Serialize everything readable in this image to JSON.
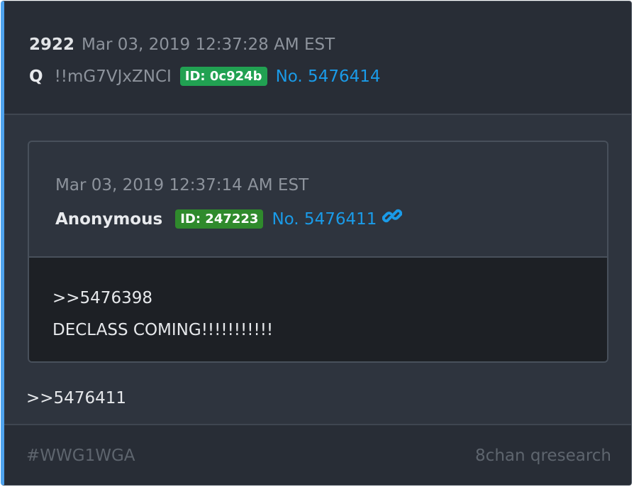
{
  "post": {
    "number": "2922",
    "date": "Mar 03, 2019 12:37:28 AM EST",
    "author": "Q",
    "tripcode": "!!mG7VJxZNCI",
    "id_badge": "ID: 0c924b",
    "post_number": "No. 5476414",
    "reply_text": ">>5476411"
  },
  "quoted": {
    "date": "Mar 03, 2019 12:37:14 AM EST",
    "author": "Anonymous",
    "id_badge": "ID: 247223",
    "post_number": "No. 5476411",
    "link_icon": "link-icon",
    "lines": [
      ">>5476398",
      "DECLASS COMING!!!!!!!!!!!"
    ]
  },
  "footer": {
    "hashtag": "#WWG1WGA",
    "source": "8chan qresearch"
  },
  "colors": {
    "accent": "#4fa3ee",
    "link": "#1a9be8",
    "q_id_badge": "#21a152",
    "anon_id_badge": "#2f8a2c"
  }
}
